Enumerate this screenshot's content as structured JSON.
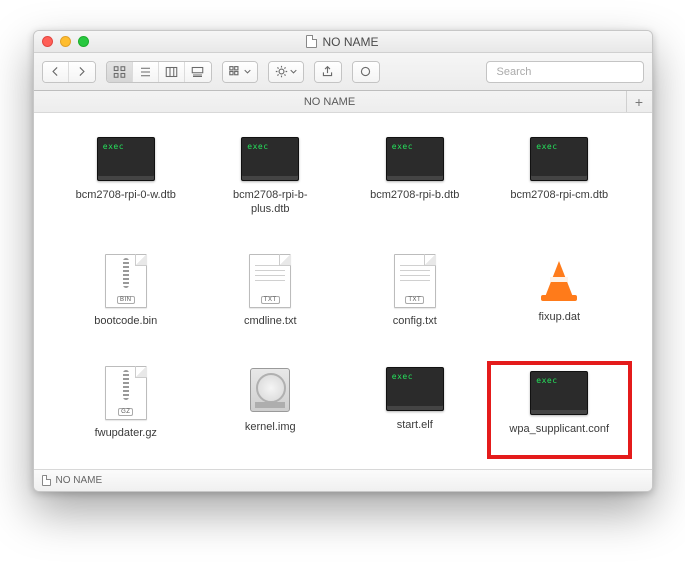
{
  "window_title": "NO NAME",
  "path_label": "NO NAME",
  "footer_label": "NO NAME",
  "search": {
    "placeholder": "Search"
  },
  "exec_label": "exec",
  "badges": {
    "bin": "BIN",
    "txt": "TXT",
    "gz": "GZ"
  },
  "files": [
    {
      "name": "bcm2708-rpi-0-w.dtb",
      "kind": "exec"
    },
    {
      "name": "bcm2708-rpi-b-plus.dtb",
      "kind": "exec"
    },
    {
      "name": "bcm2708-rpi-b.dtb",
      "kind": "exec"
    },
    {
      "name": "bcm2708-rpi-cm.dtb",
      "kind": "exec"
    },
    {
      "name": "bootcode.bin",
      "kind": "bin"
    },
    {
      "name": "cmdline.txt",
      "kind": "txt"
    },
    {
      "name": "config.txt",
      "kind": "txt"
    },
    {
      "name": "fixup.dat",
      "kind": "vlc"
    },
    {
      "name": "fwupdater.gz",
      "kind": "gz"
    },
    {
      "name": "kernel.img",
      "kind": "hdd"
    },
    {
      "name": "start.elf",
      "kind": "exec"
    },
    {
      "name": "wpa_supplicant.conf",
      "kind": "exec",
      "highlight": true
    }
  ]
}
